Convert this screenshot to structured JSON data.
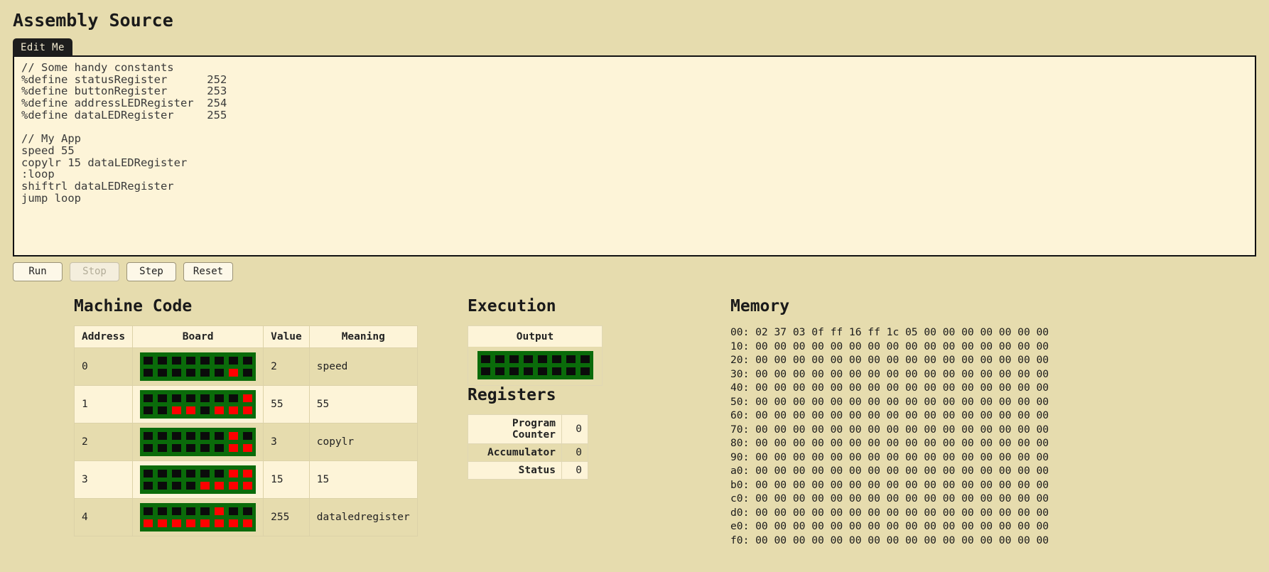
{
  "page": {
    "title": "Assembly Source",
    "bg_color": "#e6dcae",
    "panel_color": "#fdf4d8",
    "board_green": "#0a6b0a",
    "led_on_color": "#ff0000",
    "led_off_color": "#0b0b0b"
  },
  "editor": {
    "tab_label": "Edit Me",
    "code": "// Some handy constants\n%define statusRegister      252\n%define buttonRegister      253\n%define addressLEDRegister  254\n%define dataLEDRegister     255\n\n// My App\nspeed 55\ncopylr 15 dataLEDRegister\n:loop\nshiftrl dataLEDRegister\njump loop"
  },
  "controls": {
    "buttons": [
      {
        "label": "Run",
        "disabled": false
      },
      {
        "label": "Stop",
        "disabled": true
      },
      {
        "label": "Step",
        "disabled": false
      },
      {
        "label": "Reset",
        "disabled": false
      }
    ]
  },
  "machine_code": {
    "title": "Machine Code",
    "columns": [
      "Address",
      "Board",
      "Value",
      "Meaning"
    ],
    "rows": [
      {
        "address": "0",
        "value": "2",
        "meaning": "speed",
        "top_leds": [
          0,
          0,
          0,
          0,
          0,
          0,
          0,
          0
        ],
        "bottom_leds": [
          0,
          0,
          0,
          0,
          0,
          0,
          1,
          0
        ]
      },
      {
        "address": "1",
        "value": "55",
        "meaning": "55",
        "top_leds": [
          0,
          0,
          0,
          0,
          0,
          0,
          0,
          1
        ],
        "bottom_leds": [
          0,
          0,
          1,
          1,
          0,
          1,
          1,
          1
        ]
      },
      {
        "address": "2",
        "value": "3",
        "meaning": "copylr",
        "top_leds": [
          0,
          0,
          0,
          0,
          0,
          0,
          1,
          0
        ],
        "bottom_leds": [
          0,
          0,
          0,
          0,
          0,
          0,
          1,
          1
        ]
      },
      {
        "address": "3",
        "value": "15",
        "meaning": "15",
        "top_leds": [
          0,
          0,
          0,
          0,
          0,
          0,
          1,
          1
        ],
        "bottom_leds": [
          0,
          0,
          0,
          0,
          1,
          1,
          1,
          1
        ]
      },
      {
        "address": "4",
        "value": "255",
        "meaning": "dataledregister",
        "top_leds": [
          0,
          0,
          0,
          0,
          0,
          1,
          0,
          0
        ],
        "bottom_leds": [
          1,
          1,
          1,
          1,
          1,
          1,
          1,
          1
        ]
      }
    ]
  },
  "execution": {
    "title": "Execution",
    "output_label": "Output",
    "output_top_leds": [
      0,
      0,
      0,
      0,
      0,
      0,
      0,
      0
    ],
    "output_bottom_leds": [
      0,
      0,
      0,
      0,
      0,
      0,
      0,
      0
    ]
  },
  "registers": {
    "title": "Registers",
    "rows": [
      {
        "name": "Program Counter",
        "value": "0"
      },
      {
        "name": "Accumulator",
        "value": "0"
      },
      {
        "name": "Status",
        "value": "0"
      }
    ]
  },
  "memory": {
    "title": "Memory",
    "dump": "00: 02 37 03 0f ff 16 ff 1c 05 00 00 00 00 00 00 00\n10: 00 00 00 00 00 00 00 00 00 00 00 00 00 00 00 00\n20: 00 00 00 00 00 00 00 00 00 00 00 00 00 00 00 00\n30: 00 00 00 00 00 00 00 00 00 00 00 00 00 00 00 00\n40: 00 00 00 00 00 00 00 00 00 00 00 00 00 00 00 00\n50: 00 00 00 00 00 00 00 00 00 00 00 00 00 00 00 00\n60: 00 00 00 00 00 00 00 00 00 00 00 00 00 00 00 00\n70: 00 00 00 00 00 00 00 00 00 00 00 00 00 00 00 00\n80: 00 00 00 00 00 00 00 00 00 00 00 00 00 00 00 00\n90: 00 00 00 00 00 00 00 00 00 00 00 00 00 00 00 00\na0: 00 00 00 00 00 00 00 00 00 00 00 00 00 00 00 00\nb0: 00 00 00 00 00 00 00 00 00 00 00 00 00 00 00 00\nc0: 00 00 00 00 00 00 00 00 00 00 00 00 00 00 00 00\nd0: 00 00 00 00 00 00 00 00 00 00 00 00 00 00 00 00\ne0: 00 00 00 00 00 00 00 00 00 00 00 00 00 00 00 00\nf0: 00 00 00 00 00 00 00 00 00 00 00 00 00 00 00 00"
  }
}
